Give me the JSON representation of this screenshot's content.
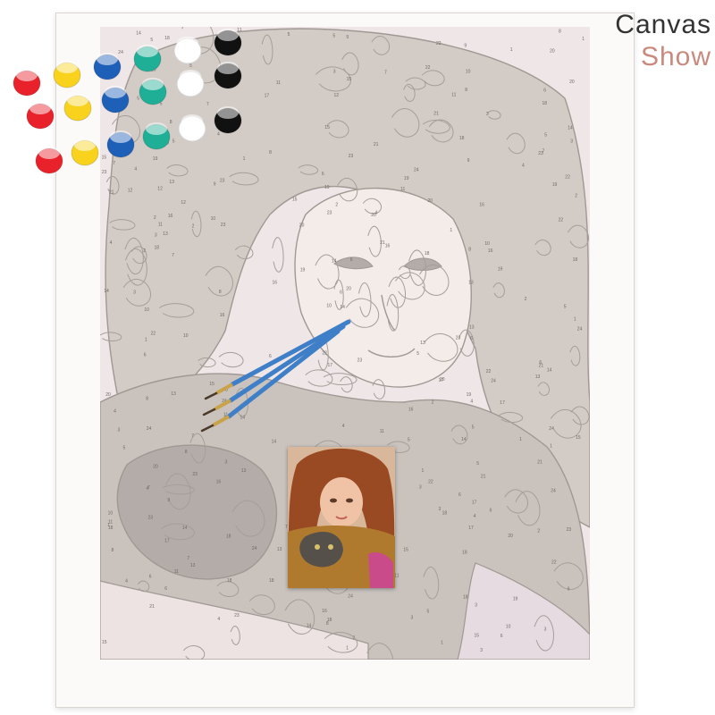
{
  "caption": {
    "line1": "Canvas",
    "line2": "Show",
    "line1_color": "#333333",
    "line2_color": "#c98a7d"
  },
  "product": {
    "kind": "paint-by-numbers canvas kit",
    "subject": "girl holding a kitten"
  },
  "palette": {
    "pot_colors": [
      "#e8212a",
      "#f8d21c",
      "#1e5fb8",
      "#1fae96",
      "#ffffff",
      "#111111"
    ]
  },
  "brushes": {
    "count": 3,
    "handle_color": "#3f7fc8",
    "ferrule_color": "#c9a24a"
  },
  "colors": {
    "canvas_base": "#efe6e7",
    "region_light": "#f3ece9",
    "region_mid": "#d2cbc6",
    "region_dark": "#b3aca8",
    "outline": "#9f9893",
    "hair_ref": "#9a4a22",
    "scarf_ref": "#b07a2e",
    "skin_ref": "#f1c3a6",
    "kitten_ref": "#55504a"
  }
}
